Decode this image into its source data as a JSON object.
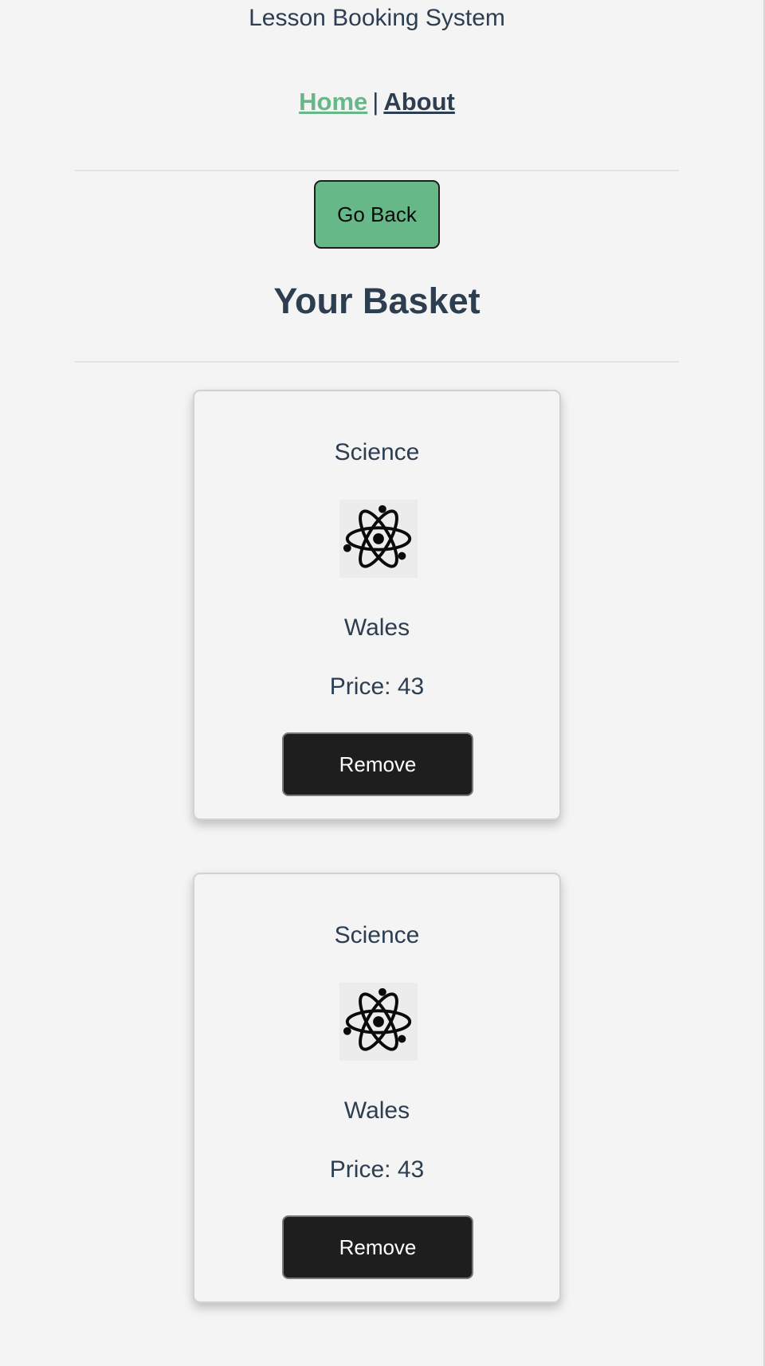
{
  "header": {
    "title": "Lesson Booking System",
    "nav": {
      "home": "Home",
      "separator": "|",
      "about": "About"
    }
  },
  "actions": {
    "go_back": "Go Back"
  },
  "basket": {
    "title": "Your Basket",
    "items": [
      {
        "subject": "Science",
        "icon": "atom-icon",
        "location": "Wales",
        "price": "Price: 43",
        "remove_label": "Remove"
      },
      {
        "subject": "Science",
        "icon": "atom-icon",
        "location": "Wales",
        "price": "Price: 43",
        "remove_label": "Remove"
      }
    ]
  },
  "colors": {
    "accent_green": "#66b889",
    "text_dark": "#2c3e50",
    "button_dark": "#1e1e1e",
    "background": "#f4f4f4"
  }
}
